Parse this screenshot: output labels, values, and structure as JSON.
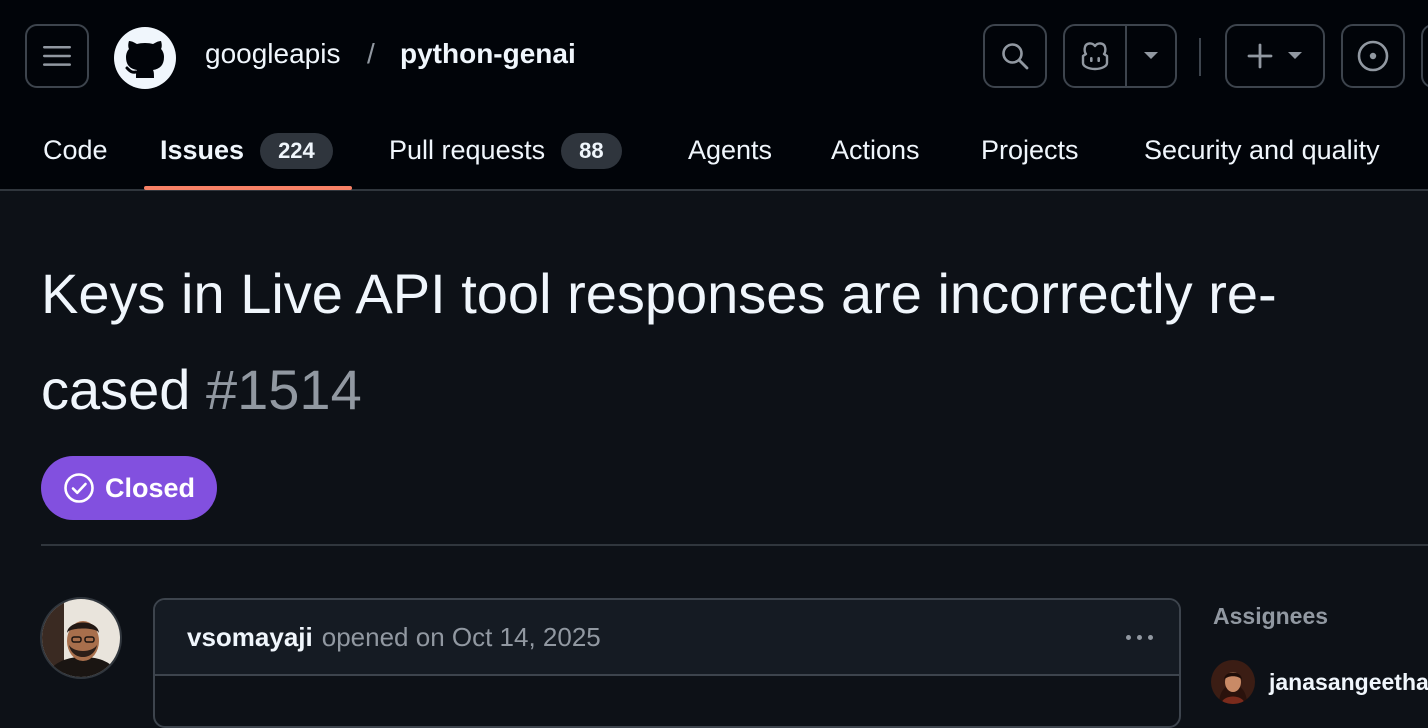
{
  "header": {
    "owner": "googleapis",
    "separator": "/",
    "repo": "python-genai",
    "icons": [
      "hamburger-menu-icon",
      "github-logo-icon",
      "search-icon",
      "copilot-icon",
      "chevron-down-icon",
      "plus-icon",
      "issue-opened-icon"
    ]
  },
  "tabs": [
    {
      "label": "Code"
    },
    {
      "label": "Issues",
      "count": "224"
    },
    {
      "label": "Pull requests",
      "count": "88"
    },
    {
      "label": "Agents"
    },
    {
      "label": "Actions"
    },
    {
      "label": "Projects"
    },
    {
      "label": "Security and quality"
    }
  ],
  "issue": {
    "title": "Keys in Live API tool responses are incorrectly re-cased",
    "number": "#1514",
    "state": "Closed",
    "author": "vsomayaji",
    "meta": "opened on Oct 14, 2025"
  },
  "sidebar": {
    "assignees_heading": "Assignees",
    "assignee": "janasangeetha"
  },
  "colors": {
    "background": "#0d1117",
    "header_bg": "#010409",
    "closed_purple": "#8250df",
    "active_tab_underline": "#f78166",
    "muted_text": "#9198a1"
  }
}
